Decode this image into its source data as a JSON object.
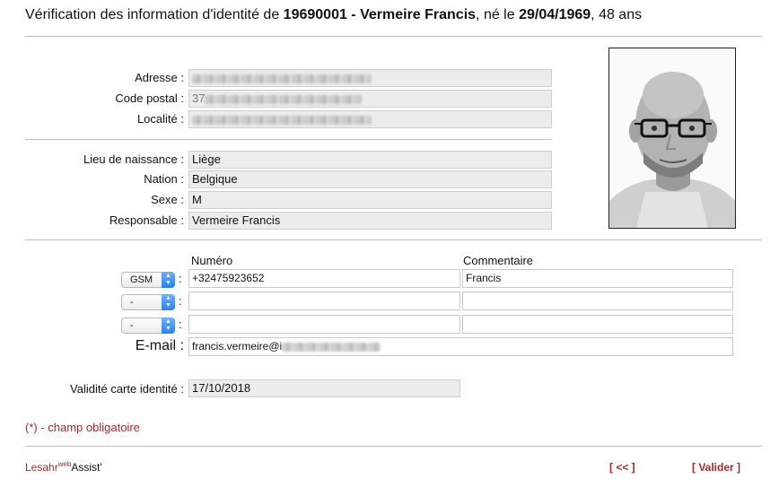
{
  "header": {
    "prefix": "Vérification des information d'identité de",
    "id_name": "19690001 - Vermeire Francis",
    "born_text": ", né le",
    "birth_date": "29/04/1969",
    "age_text": ", 48 ans"
  },
  "address": {
    "adresse_label": "Adresse :",
    "code_postal_label": "Code postal :",
    "code_postal_prefix": "37",
    "localite_label": "Localité :"
  },
  "identity": {
    "lieu_label": "Lieu de naissance :",
    "lieu_value": "Liège",
    "nation_label": "Nation :",
    "nation_value": "Belgique",
    "sexe_label": "Sexe :",
    "sexe_value": "M",
    "responsable_label": "Responsable :",
    "responsable_value": "Vermeire Francis"
  },
  "contacts": {
    "numero_header": "Numéro",
    "commentaire_header": "Commentaire",
    "rows": [
      {
        "type": "GSM",
        "numero": "+32475923652",
        "commentaire": "Francis"
      },
      {
        "type": "-",
        "numero": "",
        "commentaire": ""
      },
      {
        "type": "-",
        "numero": "",
        "commentaire": ""
      }
    ],
    "colon": ":",
    "email_label": "E-mail :",
    "email_value": "francis.vermeire@i"
  },
  "validity": {
    "label": "Validité carte identité :",
    "value": "17/10/2018"
  },
  "note": "(*) - champ obligatoire",
  "footer": {
    "brand_main": "Lesahr",
    "brand_sup": "web",
    "brand_tail": "Assist'",
    "back_label": "[ << ]",
    "validate_label": "[ Valider ]"
  },
  "colors": {
    "accent_red": "#a52a2a",
    "select_arrow_blue": "#2a7ff2"
  },
  "icons": {
    "select_arrow": "up-down-chevron-icon"
  }
}
